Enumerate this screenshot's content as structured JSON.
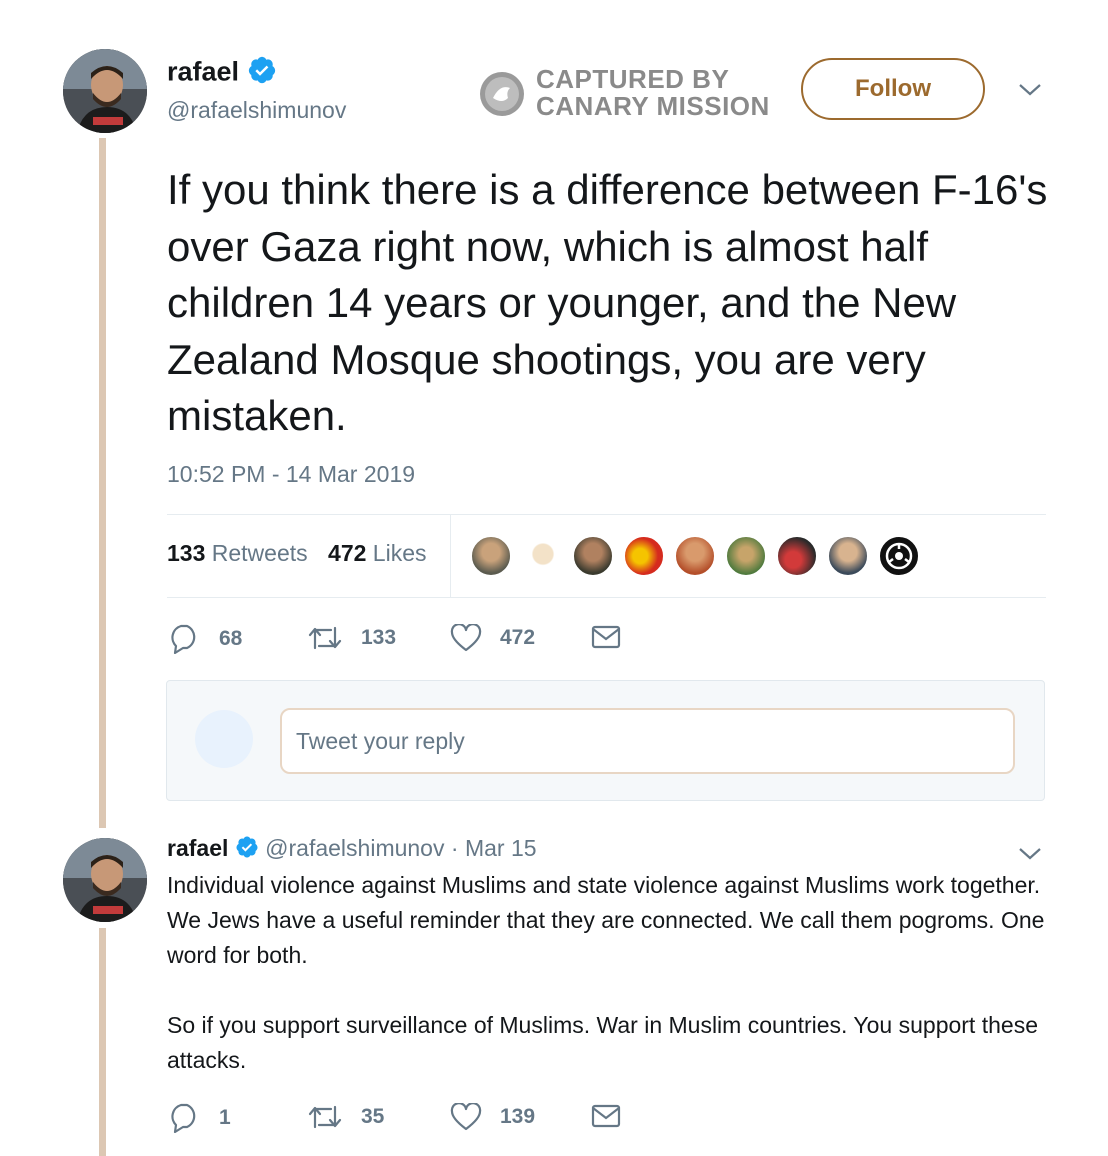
{
  "main_tweet": {
    "author_name": "rafael",
    "author_handle": "@rafaelshimunov",
    "verified_icon": "verified-badge-icon",
    "follow_label": "Follow",
    "text": "If you think there is a difference between F-16's over Gaza right now, which is almost half children 14 years or younger, and the New Zealand Mosque shootings, you are very mistaken.",
    "timestamp": "10:52 PM - 14 Mar 2019",
    "retweets_count": "133",
    "retweets_label": "Retweets",
    "likes_count": "472",
    "likes_label": "Likes",
    "actions": {
      "reply_count": "68",
      "retweet_count": "133",
      "like_count": "472"
    }
  },
  "watermark": {
    "line1": "CAPTURED BY",
    "line2": "CANARY MISSION"
  },
  "reply_box": {
    "placeholder": "Tweet your reply"
  },
  "reply_tweet": {
    "author_name": "rafael",
    "author_handle": "@rafaelshimunov",
    "separator": "·",
    "date": "Mar 15",
    "text": "Individual violence against Muslims and state violence against Muslims work together. We Jews have a useful reminder that they are connected. We call them pogroms. One word for both.\n\nSo if you support surveillance of Muslims. War in Muslim countries. You support these attacks.",
    "actions": {
      "reply_count": "1",
      "retweet_count": "35",
      "like_count": "139"
    }
  },
  "colors": {
    "accent": "#9c6a2e",
    "verified": "#1da1f2",
    "muted": "#657786",
    "thread_line": "#dcc7b3"
  }
}
